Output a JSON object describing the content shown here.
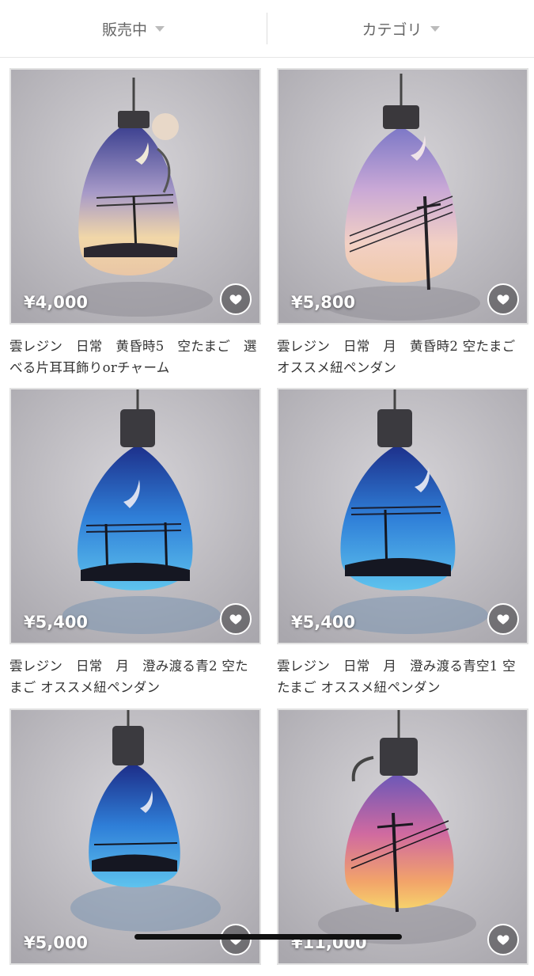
{
  "filters": {
    "status": "販売中",
    "category": "カテゴリ"
  },
  "products": [
    {
      "price": "¥4,000",
      "title": "雲レジン　日常　黄昏時5　空たまご　選べる片耳耳飾りorチャーム"
    },
    {
      "price": "¥5,800",
      "title": "雲レジン　日常　月　黄昏時2 空たまご オススメ紐ペンダン"
    },
    {
      "price": "¥5,400",
      "title": "雲レジン　日常　月　澄み渡る青2 空たまご オススメ紐ペンダン"
    },
    {
      "price": "¥5,400",
      "title": "雲レジン　日常　月　澄み渡る青空1 空たまご オススメ紐ペンダン"
    },
    {
      "price": "¥5,000",
      "title": ""
    },
    {
      "price": "¥11,000",
      "title": ""
    }
  ],
  "icons": {
    "favorite": "heart-icon",
    "dropdown": "caret-down-icon"
  },
  "colors": {
    "price_text": "#ffffff",
    "fav_bg": "#00000059"
  }
}
